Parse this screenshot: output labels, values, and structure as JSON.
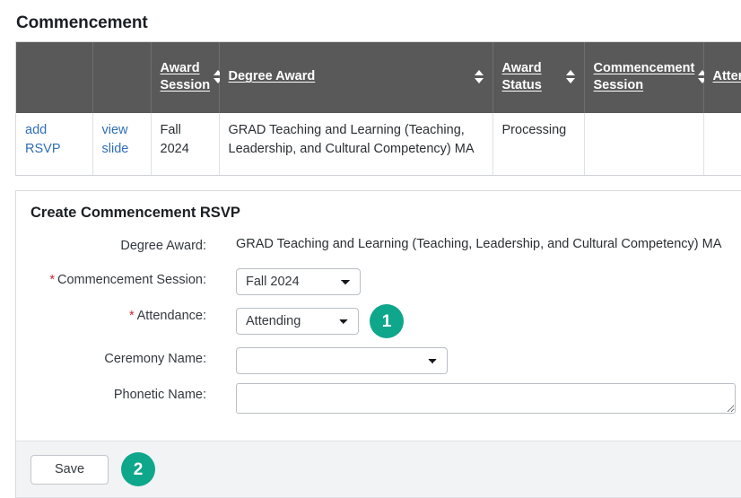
{
  "page": {
    "title": "Commencement"
  },
  "results_table": {
    "columns": [
      {
        "label": "",
        "sortable": false
      },
      {
        "label": "",
        "sortable": false
      },
      {
        "label": "Award Session",
        "sortable": true
      },
      {
        "label": "Degree Award",
        "sortable": true
      },
      {
        "label": "Award Status",
        "sortable": true
      },
      {
        "label": "Commencement Session",
        "sortable": true
      },
      {
        "label": "Attendance",
        "sortable": true
      }
    ],
    "rows": [
      {
        "add_link": "add RSVP",
        "view_link": "view slide",
        "award_session": "Fall 2024",
        "degree_award": "GRAD Teaching and Learning (Teaching, Leadership, and Cultural Competency) MA",
        "award_status": "Processing",
        "commencement_session": "",
        "attendance": ""
      }
    ]
  },
  "form": {
    "title": "Create Commencement RSVP",
    "fields": {
      "degree_award": {
        "label": "Degree Award:",
        "required": false,
        "value": "GRAD Teaching and Learning (Teaching, Leadership, and Cultural Competency) MA"
      },
      "commencement_session": {
        "label": "Commencement Session:",
        "required": true,
        "value": "Fall 2024",
        "options": [
          "Fall 2024"
        ]
      },
      "attendance": {
        "label": "Attendance:",
        "required": true,
        "value": "Attending",
        "options": [
          "Attending"
        ],
        "badge": "1"
      },
      "ceremony_name": {
        "label": "Ceremony Name:",
        "required": false,
        "value": "",
        "options": [
          ""
        ]
      },
      "phonetic_name": {
        "label": "Phonetic Name:",
        "required": false,
        "value": "",
        "placeholder": ""
      }
    },
    "footer": {
      "save_label": "Save",
      "badge": "2"
    }
  },
  "colors": {
    "accent_badge": "#0fa78b",
    "table_header_bg": "#595959",
    "link": "#2f6fb5",
    "required_star": "#c32b36",
    "footer_bg": "#f1f3f5"
  },
  "symbols": {
    "required_star": "*"
  }
}
